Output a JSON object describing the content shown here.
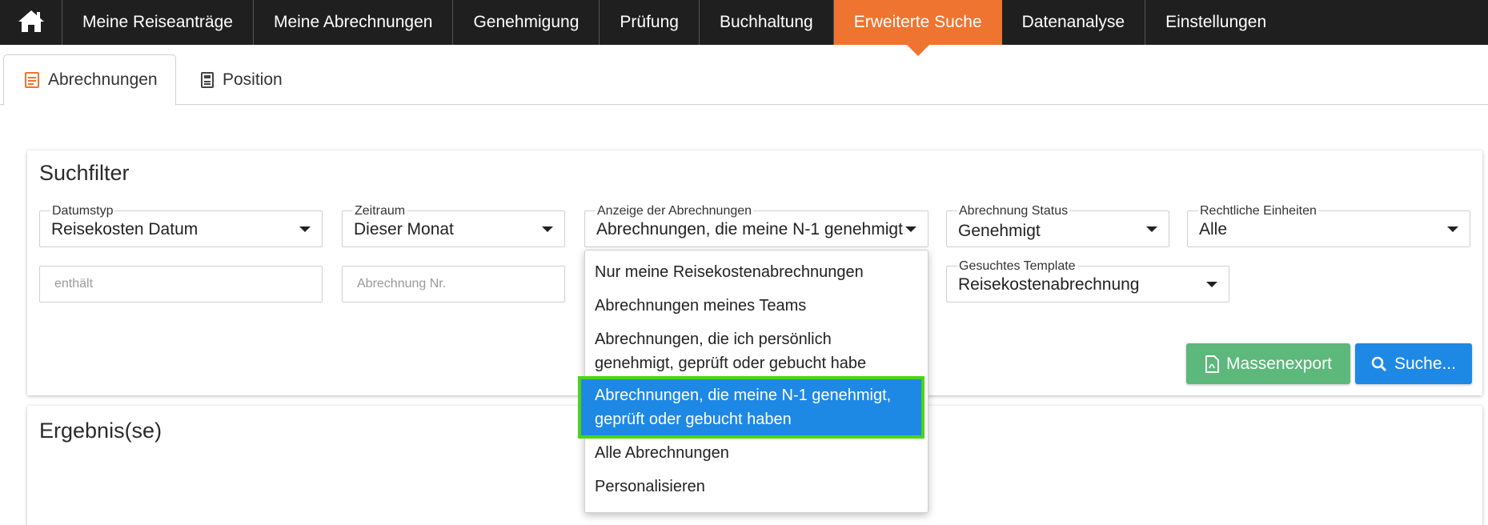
{
  "nav": {
    "home_icon": "home-icon",
    "items": [
      {
        "label": "Meine Reiseanträge"
      },
      {
        "label": "Meine Abrechnungen"
      },
      {
        "label": "Genehmigung"
      },
      {
        "label": "Prüfung"
      },
      {
        "label": "Buchhaltung"
      },
      {
        "label": "Erweiterte Suche",
        "active": true
      },
      {
        "label": "Datenanalyse"
      },
      {
        "label": "Einstellungen"
      }
    ],
    "colors": {
      "bar": "#1f1f1f",
      "active": "#ee7430"
    }
  },
  "tabs": [
    {
      "label": "Abrechnungen",
      "icon": "receipt-icon",
      "active": true
    },
    {
      "label": "Position",
      "icon": "document-icon",
      "active": false
    }
  ],
  "filter": {
    "title": "Suchfilter",
    "datumstyp": {
      "label": "Datumstyp",
      "value": "Reisekosten Datum"
    },
    "zeitraum": {
      "label": "Zeitraum",
      "value": "Dieser Monat"
    },
    "anzeige": {
      "label": "Anzeige der Abrechnungen",
      "value": "Abrechnungen, die meine N-1 genehmigt,"
    },
    "status": {
      "label": "Abrechnung Status",
      "value": "Genehmigt"
    },
    "einheiten": {
      "label": "Rechtliche Einheiten",
      "value": "Alle"
    },
    "enthaelt": {
      "placeholder": "enthält"
    },
    "abrechnung_nr": {
      "placeholder": "Abrechnung Nr."
    },
    "template": {
      "label": "Gesuchtes Template",
      "value": "Reisekostenabrechnung"
    },
    "export_button": "Massenexport",
    "search_button": "Suche...",
    "colors": {
      "export": "#5cb87b",
      "search": "#1e88e5"
    }
  },
  "dropdown": {
    "options": [
      {
        "line1": "Nur meine Reisekostenabrechnungen",
        "line2": ""
      },
      {
        "line1": "Abrechnungen meines Teams",
        "line2": ""
      },
      {
        "line1": "Abrechnungen, die ich persönlich",
        "line2": "genehmigt, geprüft oder gebucht habe"
      },
      {
        "line1": "Abrechnungen, die meine N-1 genehmigt,",
        "line2": "geprüft oder gebucht haben",
        "selected": true
      },
      {
        "line1": "Alle Abrechnungen",
        "line2": ""
      },
      {
        "line1": "Personalisieren",
        "line2": ""
      }
    ],
    "colors": {
      "selected": "#1e88e5",
      "highlight_border": "#4dd414"
    }
  },
  "results": {
    "title": "Ergebnis(se)"
  }
}
